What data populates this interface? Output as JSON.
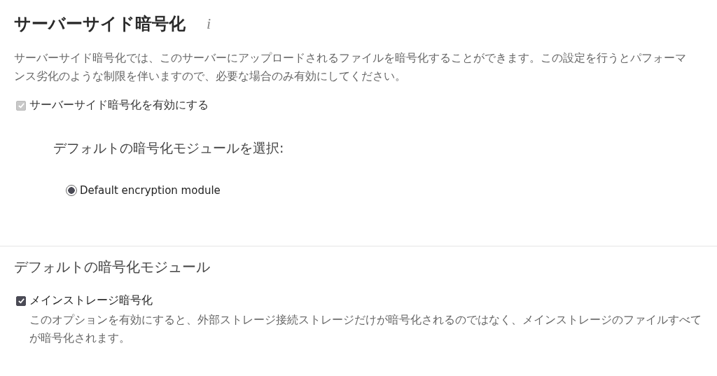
{
  "server_side": {
    "title": "サーバーサイド暗号化",
    "info": "i",
    "description": "サーバーサイド暗号化では、このサーバーにアップロードされるファイルを暗号化することができます。この設定を行うとパフォーマンス劣化のような制限を伴いますので、必要な場合のみ有効にしてください。",
    "enable": {
      "label": "サーバーサイド暗号化を有効にする",
      "checked": true,
      "disabled": true
    },
    "module_heading": "デフォルトの暗号化モジュールを選択:",
    "modules": [
      {
        "label": "Default encryption module",
        "selected": true
      }
    ]
  },
  "default_module": {
    "title": "デフォルトの暗号化モジュール",
    "options": [
      {
        "label": "メインストレージ暗号化",
        "checked": true,
        "disabled": false,
        "hint": "このオプションを有効にすると、外部ストレージ接続ストレージだけが暗号化されるのではなく、メインストレージのファイルすべてが暗号化されます。"
      }
    ]
  }
}
